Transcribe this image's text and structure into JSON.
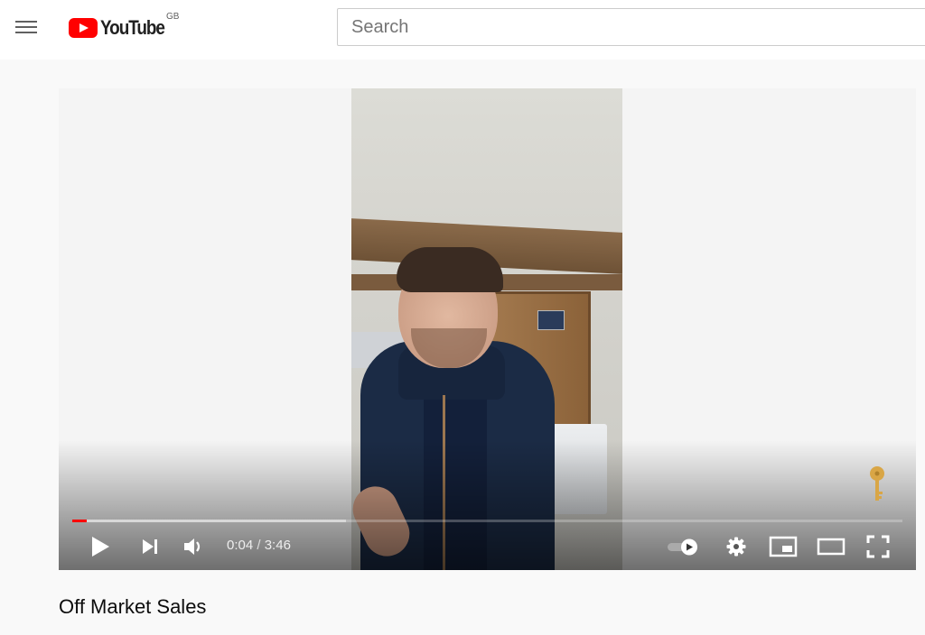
{
  "header": {
    "logo_text": "YouTube",
    "region": "GB",
    "search_placeholder": "Search"
  },
  "player": {
    "current_time": "0:04",
    "time_separator": " / ",
    "duration": "3:46",
    "progress_fraction": 0.0177,
    "buffered_fraction": 0.33,
    "icons": [
      "menu-icon",
      "play-icon",
      "next-icon",
      "volume-icon",
      "autoplay-toggle-icon",
      "settings-gear-icon",
      "miniplayer-icon",
      "theater-mode-icon",
      "fullscreen-icon",
      "key-icon"
    ],
    "accent_color": "#ff0000"
  },
  "video": {
    "title": "Off Market Sales"
  }
}
